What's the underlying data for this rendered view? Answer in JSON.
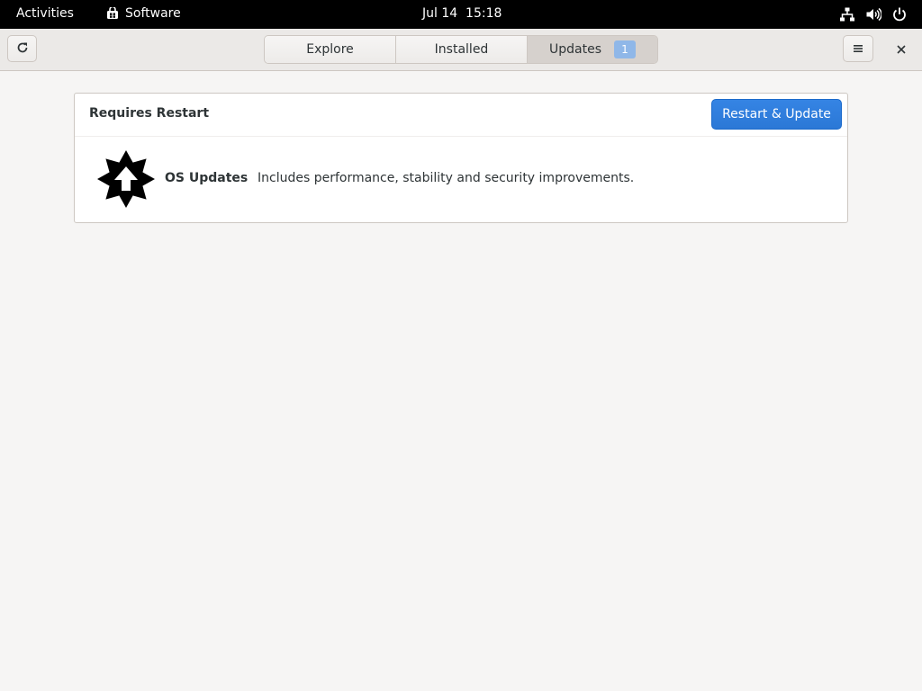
{
  "topbar": {
    "activities": "Activities",
    "app_name": "Software",
    "clock": "Jul 14  15:18",
    "icons": [
      "network-icon",
      "volume-icon",
      "power-icon"
    ]
  },
  "headerbar": {
    "refresh_icon": "refresh-icon",
    "tabs": [
      {
        "label": "Explore"
      },
      {
        "label": "Installed"
      },
      {
        "label": "Updates",
        "badge": "1",
        "active": true
      }
    ],
    "menu_icon": "hamburger-icon",
    "close_icon": "close-icon"
  },
  "updates": {
    "section_title": "Requires Restart",
    "action_label": "Restart & Update",
    "accent_color": "#3584e4",
    "items": [
      {
        "icon": "os-update-icon",
        "name": "OS Updates",
        "description": "Includes performance, stability and security improvements."
      }
    ]
  }
}
